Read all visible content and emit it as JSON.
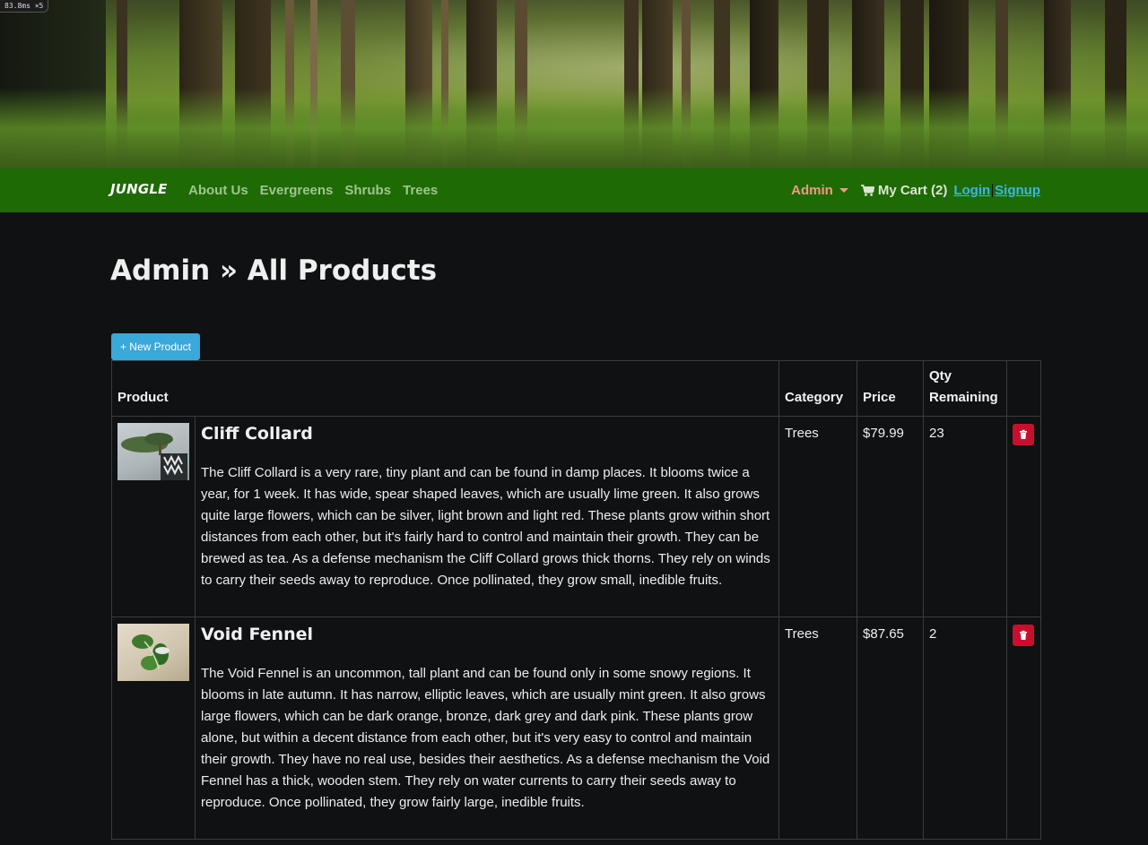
{
  "perf_badge": "83.8ms ×5",
  "navbar": {
    "brand": "JUNGLE",
    "links": [
      "About Us",
      "Evergreens",
      "Shrubs",
      "Trees"
    ],
    "admin_label": "Admin",
    "cart_label": "My Cart (2)",
    "login_label": "Login",
    "signup_label": "Signup"
  },
  "page_title": "Admin » All Products",
  "new_product_label": "+ New Product",
  "table": {
    "headers": [
      "Product",
      "Category",
      "Price",
      "Qty Remaining"
    ],
    "rows": [
      {
        "name": "Cliff Collard",
        "description": "The Cliff Collard is a very rare, tiny plant and can be found in damp places. It blooms twice a year, for 1 week. It has wide, spear shaped leaves, which are usually lime green. It also grows quite large flowers, which can be silver, light brown and light red. These plants grow within short distances from each other, but it's fairly hard to control and maintain their growth. They can be brewed as tea. As a defense mechanism the Cliff Collard grows thick thorns. They rely on winds to carry their seeds away to reproduce. Once pollinated, they grow small, inedible fruits.",
        "category": "Trees",
        "price": "$79.99",
        "qty": "23"
      },
      {
        "name": "Void Fennel",
        "description": "The Void Fennel is an uncommon, tall plant and can be found only in some snowy regions. It blooms in late autumn. It has narrow, elliptic leaves, which are usually mint green. It also grows large flowers, which can be dark orange, bronze, dark grey and dark pink. These plants grow alone, but within a decent distance from each other, but it's very easy to control and maintain their growth. They have no real use, besides their aesthetics. As a defense mechanism the Void Fennel has a thick, wooden stem. They rely on water currents to carry their seeds away to reproduce. Once pollinated, they grow fairly large, inedible fruits.",
        "category": "Trees",
        "price": "$87.65",
        "qty": "2"
      }
    ]
  },
  "colors": {
    "navbar_bg": "#1e6a04",
    "admin_link": "#f19a85",
    "auth_link": "#3fb4e8",
    "new_button": "#3aa8d8",
    "delete_button": "#c8102e",
    "page_bg": "#0f1112"
  },
  "icons": {
    "cart": "shopping-cart-icon",
    "delete": "trash-icon",
    "admin_caret": "caret-down-icon"
  }
}
